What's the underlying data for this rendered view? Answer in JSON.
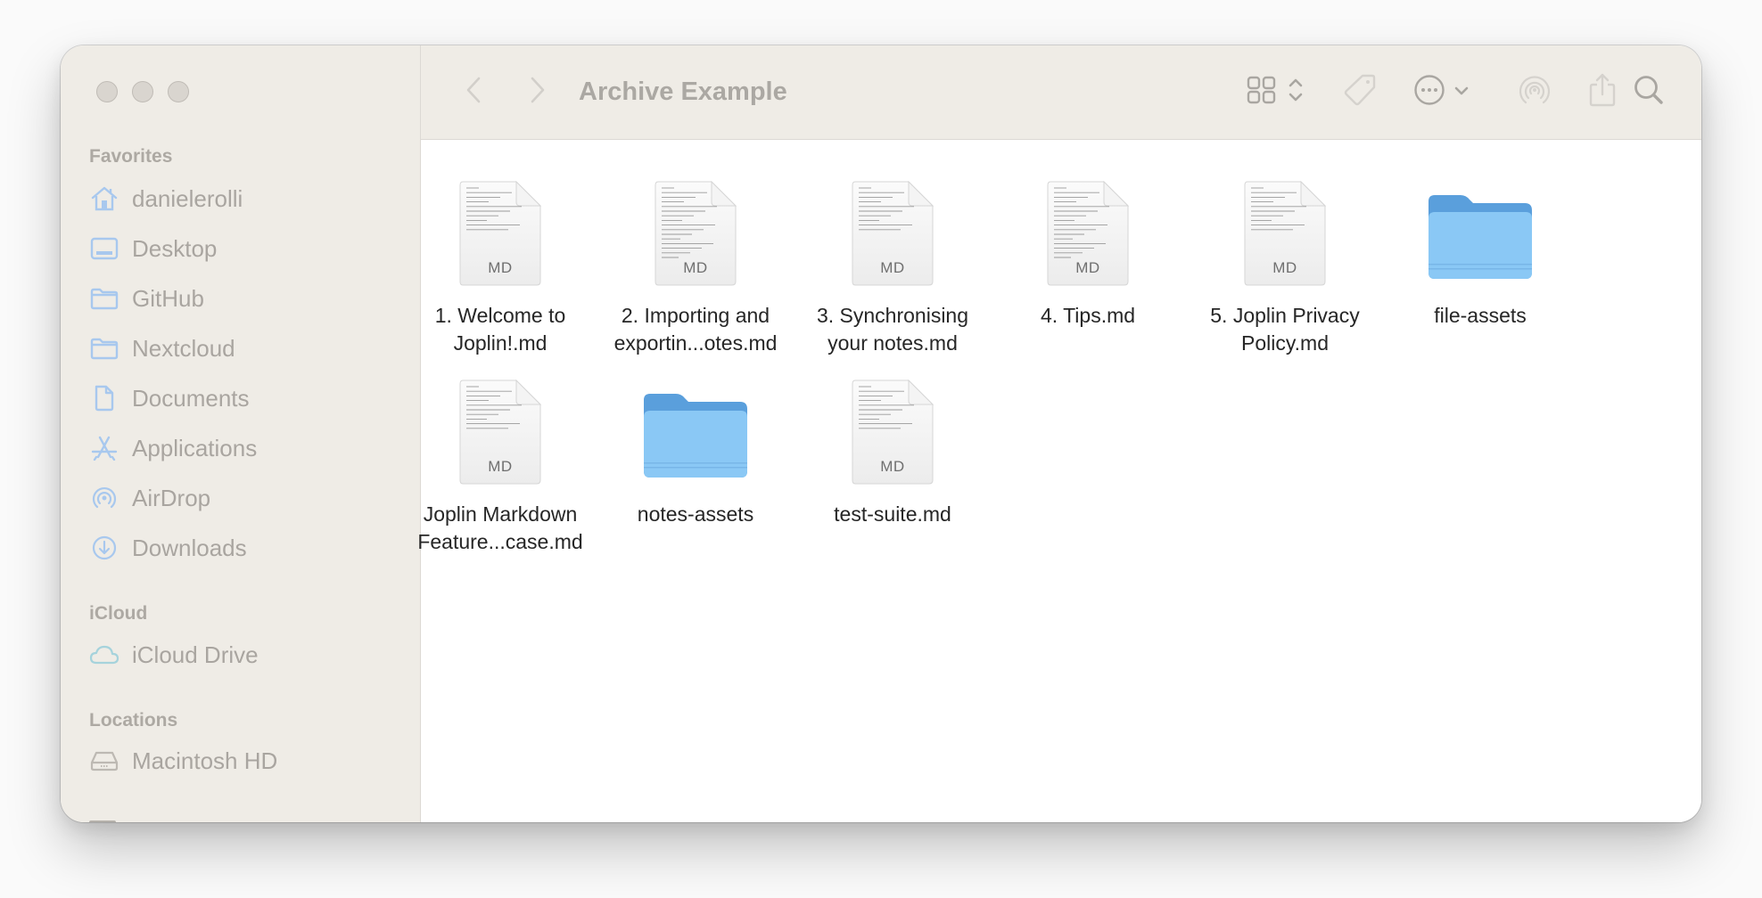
{
  "window": {
    "title": "Archive Example",
    "traffic_lights": [
      "close",
      "minimize",
      "zoom"
    ]
  },
  "toolbar": {
    "back_icon": "chevron-left-icon",
    "forward_icon": "chevron-right-icon",
    "view_icon": "grid-view-icon",
    "sort_icon": "up-down-chevron-icon",
    "tag_icon": "tag-icon",
    "more_icon": "ellipsis-circle-icon",
    "more_chevron_icon": "chevron-down-icon",
    "airdrop_icon": "airdrop-icon",
    "share_icon": "share-icon",
    "search_icon": "search-icon"
  },
  "sidebar": {
    "sections": [
      {
        "header": "Favorites",
        "items": [
          {
            "label": "danielerolli",
            "icon": "home-icon"
          },
          {
            "label": "Desktop",
            "icon": "desktop-icon"
          },
          {
            "label": "GitHub",
            "icon": "folder-icon"
          },
          {
            "label": "Nextcloud",
            "icon": "folder-icon"
          },
          {
            "label": "Documents",
            "icon": "document-icon"
          },
          {
            "label": "Applications",
            "icon": "applications-icon"
          },
          {
            "label": "AirDrop",
            "icon": "airdrop-icon"
          },
          {
            "label": "Downloads",
            "icon": "download-icon"
          }
        ]
      },
      {
        "header": "iCloud",
        "items": [
          {
            "label": "iCloud Drive",
            "icon": "cloud-icon"
          }
        ]
      },
      {
        "header": "Locations",
        "items": [
          {
            "label": "Macintosh HD",
            "icon": "hard-drive-icon"
          }
        ]
      }
    ]
  },
  "files": [
    {
      "name": "1. Welcome to Joplin!.md",
      "line1": "1. Welcome to",
      "line2": "Joplin!.md",
      "kind": "md",
      "badge": "MD"
    },
    {
      "name": "2. Importing and exportin...otes.md",
      "line1": "2. Importing and",
      "line2": "exportin...otes.md",
      "kind": "md",
      "badge": "MD"
    },
    {
      "name": "3. Synchronising your notes.md",
      "line1": "3. Synchronising",
      "line2": "your notes.md",
      "kind": "md",
      "badge": "MD"
    },
    {
      "name": "4. Tips.md",
      "line1": "4. Tips.md",
      "line2": "",
      "kind": "md",
      "badge": "MD"
    },
    {
      "name": "5. Joplin Privacy Policy.md",
      "line1": "5. Joplin Privacy",
      "line2": "Policy.md",
      "kind": "md",
      "badge": "MD"
    },
    {
      "name": "file-assets",
      "line1": "file-assets",
      "line2": "",
      "kind": "folder",
      "badge": ""
    },
    {
      "name": "Joplin Markdown Feature...case.md",
      "line1": "Joplin Markdown",
      "line2": "Feature...case.md",
      "kind": "md",
      "badge": "MD"
    },
    {
      "name": "notes-assets",
      "line1": "notes-assets",
      "line2": "",
      "kind": "folder",
      "badge": ""
    },
    {
      "name": "test-suite.md",
      "line1": "test-suite.md",
      "line2": "",
      "kind": "md",
      "badge": "MD"
    }
  ],
  "colors": {
    "sidebar_bg": "#efece6",
    "sidebar_icon": "#a8c8ee",
    "sidebar_text": "#a9a5a0",
    "folder_front": "#8ac8f5",
    "folder_back": "#5a9fdc",
    "file_label": "#262626"
  }
}
